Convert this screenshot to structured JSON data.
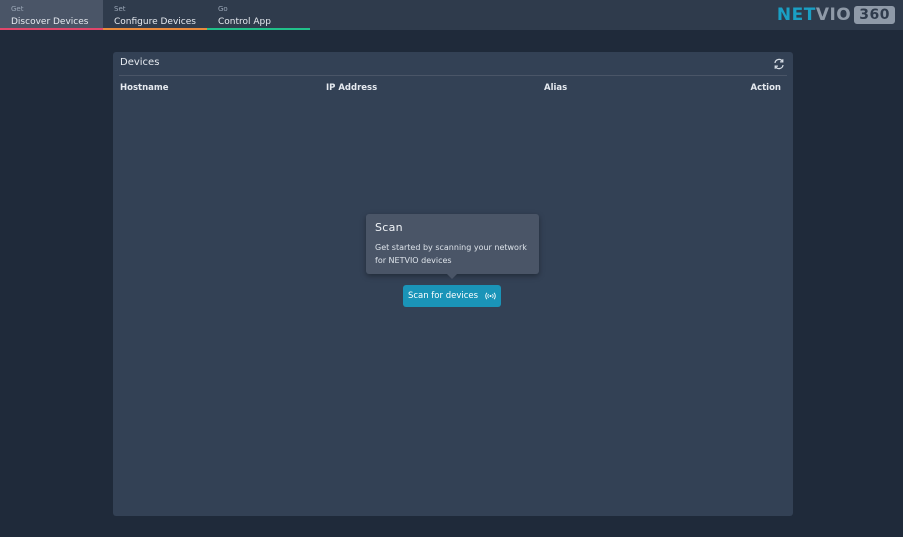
{
  "nav": {
    "tabs": [
      {
        "step": "Get",
        "label": "Discover Devices",
        "accent": "#e0476b"
      },
      {
        "step": "Set",
        "label": "Configure Devices",
        "accent": "#e98a3c"
      },
      {
        "step": "Go",
        "label": "Control App",
        "accent": "#21c08a"
      }
    ],
    "active_tab": "Discover Devices"
  },
  "brand": {
    "part1": "NET",
    "part2": "VIO",
    "part3": "360",
    "colors": {
      "primary": "#1a9fc4",
      "secondary": "#8f9aa8"
    }
  },
  "devices_panel": {
    "title": "Devices",
    "refresh_icon": "refresh-icon",
    "columns": [
      "Hostname",
      "IP Address",
      "Alias",
      "Action"
    ],
    "rows": []
  },
  "scan_tooltip": {
    "title": "Scan",
    "body": "Get started by scanning your network for NETVIO devices"
  },
  "scan_button": {
    "label": "Scan for devices",
    "icon": "broadcast-icon",
    "color": "#1a94b8"
  }
}
